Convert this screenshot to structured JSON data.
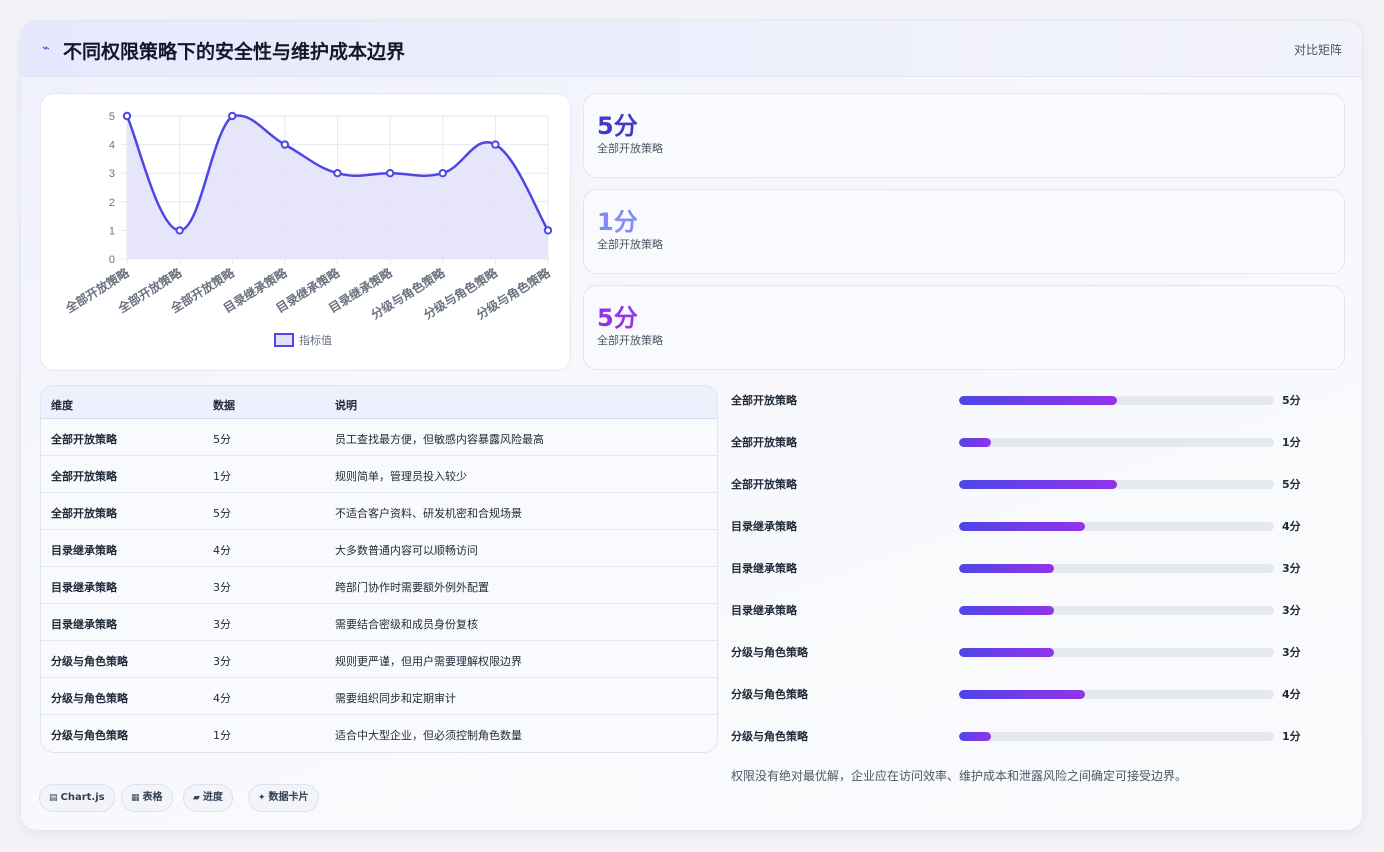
{
  "header": {
    "icon": "trend-icon",
    "title": "不同权限策略下的安全性与维护成本边界",
    "tag": "对比矩阵"
  },
  "chart_data": {
    "type": "line",
    "categories": [
      "全部开放策略",
      "全部开放策略",
      "全部开放策略",
      "目录继承策略",
      "目录继承策略",
      "目录继承策略",
      "分级与角色策略",
      "分级与角色策略",
      "分级与角色策略"
    ],
    "series": [
      {
        "name": "指标值",
        "values": [
          5,
          1,
          5,
          4,
          3,
          3,
          3,
          4,
          1
        ]
      }
    ],
    "ylim": [
      0,
      5
    ],
    "yticks": [
      "0",
      "1",
      "2",
      "3",
      "4",
      "5"
    ],
    "grid": true,
    "legend": "bottom",
    "colors": {
      "line": "#4f46e5",
      "fill": "#e4e2fa"
    }
  },
  "stats": [
    {
      "value": "5分",
      "label": "全部开放策略",
      "color": "#4338ca"
    },
    {
      "value": "1分",
      "label": "全部开放策略",
      "color": "#818cf8"
    },
    {
      "value": "5分",
      "label": "全部开放策略",
      "color": "#9333ea"
    }
  ],
  "table": {
    "headers": [
      "维度",
      "数据",
      "说明"
    ],
    "rows": [
      [
        "全部开放策略",
        "5分",
        "员工查找最方便，但敏感内容暴露风险最高"
      ],
      [
        "全部开放策略",
        "1分",
        "规则简单，管理员投入较少"
      ],
      [
        "全部开放策略",
        "5分",
        "不适合客户资料、研发机密和合规场景"
      ],
      [
        "目录继承策略",
        "4分",
        "大多数普通内容可以顺畅访问"
      ],
      [
        "目录继承策略",
        "3分",
        "跨部门协作时需要额外例外配置"
      ],
      [
        "目录继承策略",
        "3分",
        "需要结合密级和成员身份复核"
      ],
      [
        "分级与角色策略",
        "3分",
        "规则更严谨，但用户需要理解权限边界"
      ],
      [
        "分级与角色策略",
        "4分",
        "需要组织同步和定期审计"
      ],
      [
        "分级与角色策略",
        "1分",
        "适合中大型企业，但必须控制角色数量"
      ]
    ]
  },
  "bars": {
    "max": 10,
    "items": [
      {
        "name": "全部开放策略",
        "value": 5,
        "label": "5分"
      },
      {
        "name": "全部开放策略",
        "value": 1,
        "label": "1分"
      },
      {
        "name": "全部开放策略",
        "value": 5,
        "label": "5分"
      },
      {
        "name": "目录继承策略",
        "value": 4,
        "label": "4分"
      },
      {
        "name": "目录继承策略",
        "value": 3,
        "label": "3分"
      },
      {
        "name": "目录继承策略",
        "value": 3,
        "label": "3分"
      },
      {
        "name": "分级与角色策略",
        "value": 3,
        "label": "3分"
      },
      {
        "name": "分级与角色策略",
        "value": 4,
        "label": "4分"
      },
      {
        "name": "分级与角色策略",
        "value": 1,
        "label": "1分"
      }
    ]
  },
  "note": "权限没有绝对最优解，企业应在访问效率、维护成本和泄露风险之间确定可接受边界。",
  "chips": [
    {
      "icon": "▤",
      "label": "Chart.js"
    },
    {
      "icon": "▦",
      "label": "表格"
    },
    {
      "icon": "▰",
      "label": "进度"
    },
    {
      "icon": "✦",
      "label": "数据卡片"
    }
  ]
}
